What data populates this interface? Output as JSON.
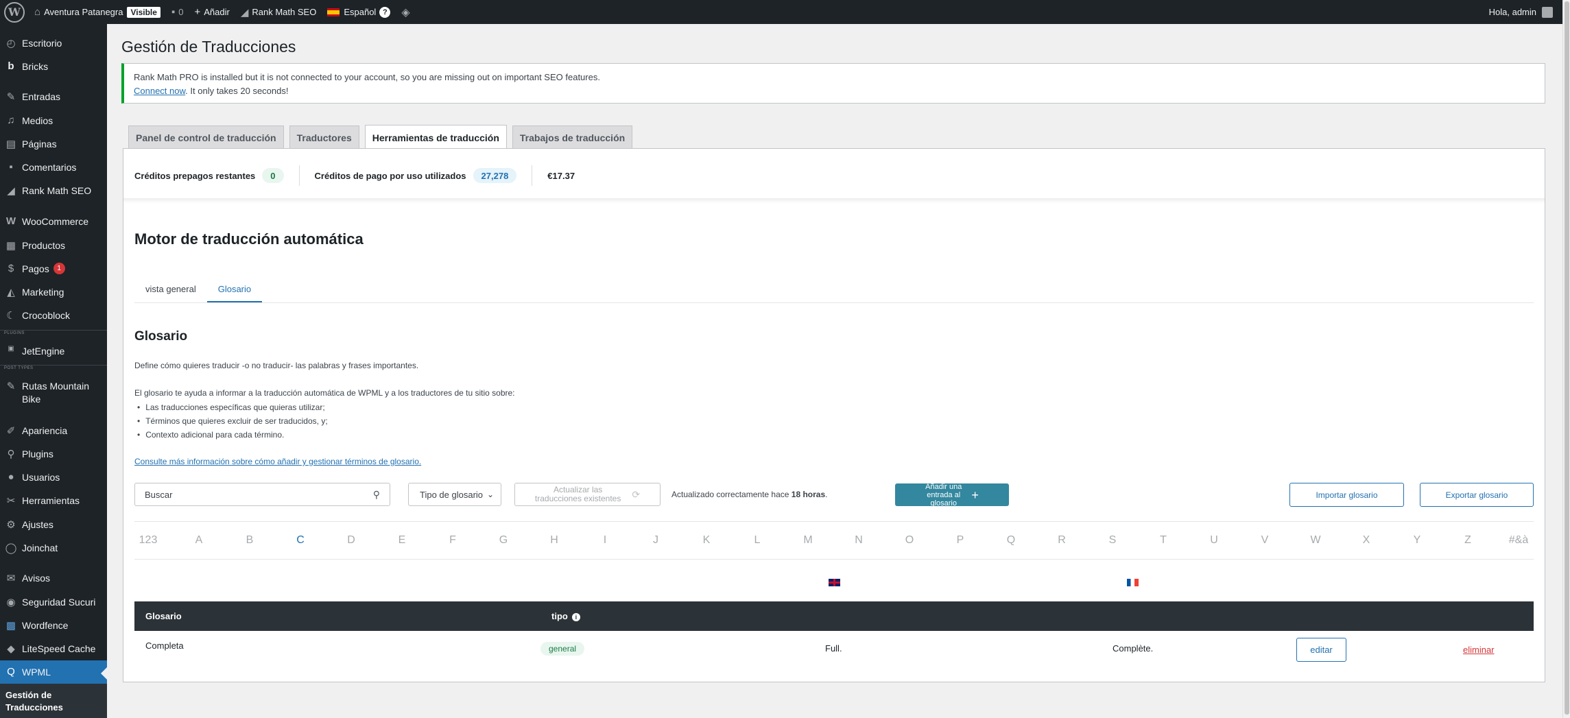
{
  "adminbar": {
    "site_name": "Aventura Patanegra",
    "visible_badge": "Visible",
    "comments_count": "0",
    "add_new": "Añadir",
    "rank_math": "Rank Math SEO",
    "language": "Español",
    "greeting": "Hola, admin"
  },
  "sidebar": {
    "items": [
      {
        "label": "Escritorio"
      },
      {
        "label": "Bricks"
      },
      {
        "label": "Entradas"
      },
      {
        "label": "Medios"
      },
      {
        "label": "Páginas"
      },
      {
        "label": "Comentarios"
      },
      {
        "label": "Rank Math SEO"
      },
      {
        "label": "WooCommerce"
      },
      {
        "label": "Productos"
      },
      {
        "label": "Pagos",
        "badge": "1"
      },
      {
        "label": "Marketing"
      },
      {
        "label": "Crocoblock"
      },
      {
        "label": "JetEngine"
      },
      {
        "label": "Rutas Mountain Bike"
      },
      {
        "label": "Apariencia"
      },
      {
        "label": "Plugins"
      },
      {
        "label": "Usuarios"
      },
      {
        "label": "Herramientas"
      },
      {
        "label": "Ajustes"
      },
      {
        "label": "Joinchat"
      },
      {
        "label": "Avisos"
      },
      {
        "label": "Seguridad Sucuri"
      },
      {
        "label": "Wordfence"
      },
      {
        "label": "LiteSpeed Cache"
      },
      {
        "label": "WPML"
      }
    ],
    "sep_plugins": "PLUGINS",
    "sep_post_types": "POST TYPES",
    "current_submenu": "Gestión de Traducciones"
  },
  "page": {
    "title": "Gestión de Traducciones"
  },
  "notice": {
    "text": "Rank Math PRO is installed but it is not connected to your account, so you are missing out on important SEO features.",
    "link": "Connect now",
    "text2": ". It only takes 20 seconds!"
  },
  "tabs": [
    {
      "label": "Panel de control de traducción"
    },
    {
      "label": "Traductores"
    },
    {
      "label": "Herramientas de traducción"
    },
    {
      "label": "Trabajos de traducción"
    }
  ],
  "credits": {
    "prepaid_label": "Créditos prepagos restantes",
    "prepaid_value": "0",
    "payg_label": "Créditos de pago por uso utilizados",
    "payg_value": "27,278",
    "amount": "€17.37"
  },
  "engine": {
    "title": "Motor de traducción automática",
    "subtab_overview": "vista general",
    "subtab_glossary": "Glosario"
  },
  "glossary": {
    "heading": "Glosario",
    "desc1": "Define cómo quieres traducir -o no traducir- las palabras y frases importantes.",
    "desc2": "El glosario te ayuda a informar a la traducción automática de WPML y a los traductores de tu sitio sobre:",
    "bullet1": "Las traducciones específicas que quieras utilizar;",
    "bullet2": "Términos que quieres excluir de ser traducidos, y;",
    "bullet3": "Contexto adicional para cada término.",
    "info_link": "Consulte más información sobre cómo añadir y gestionar términos de glosario."
  },
  "toolbar": {
    "search_placeholder": "Buscar",
    "type_select": "Tipo de glosario",
    "refresh_line1": "Actualizar las",
    "refresh_line2": "traducciones existentes",
    "updated_prefix": "Actualizado correctamente hace ",
    "updated_value": "18 horas",
    "updated_suffix": ".",
    "add_line1": "Añadir una",
    "add_line2": "entrada al",
    "add_line3": "glosario",
    "import": "Importar glosario",
    "export": "Exportar glosario"
  },
  "alphabet": [
    "123",
    "A",
    "B",
    "C",
    "D",
    "E",
    "F",
    "G",
    "H",
    "I",
    "J",
    "K",
    "L",
    "M",
    "N",
    "O",
    "P",
    "Q",
    "R",
    "S",
    "T",
    "U",
    "V",
    "W",
    "X",
    "Y",
    "Z",
    "#&à"
  ],
  "alphabet_active": "C",
  "table": {
    "col_glossary": "Glosario",
    "col_type": "tipo",
    "rows": [
      {
        "term": "Completa",
        "type": "general",
        "en": "Full.",
        "fr": "Complète.",
        "edit": "editar",
        "delete": "eliminar"
      }
    ]
  },
  "colors": {
    "accent": "#2271b1",
    "admin_dark": "#1d2327",
    "add_button": "#33879e",
    "notice_border": "#00a32a",
    "danger": "#d63638"
  }
}
